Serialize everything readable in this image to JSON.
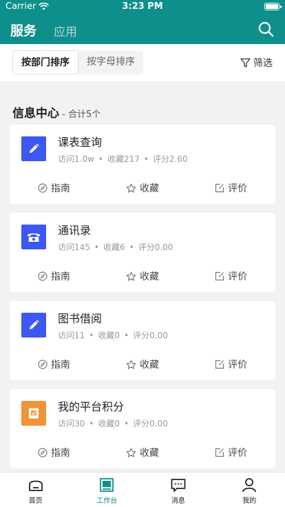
{
  "status": {
    "carrier": "Carrier",
    "time": "3:23 PM"
  },
  "header": {
    "tab_service": "服务",
    "tab_app": "应用"
  },
  "sort": {
    "by_dept": "按部门排序",
    "by_letter": "按字母排序",
    "filter": "筛选"
  },
  "section": {
    "title": "信息中心",
    "total": " - 合计5个"
  },
  "actions": {
    "guide": "指南",
    "favorite": "收藏",
    "review": "评价"
  },
  "colors": {
    "primary": "#0f8f8b",
    "icon_blue": "#3d57f4",
    "icon_orange": "#f09435"
  },
  "cards": [
    {
      "title": "课表查询",
      "visits": "访问1.0w",
      "favorites": "收藏217",
      "rating": "评分2.60",
      "icon": "pencil-icon"
    },
    {
      "title": "通讯录",
      "visits": "访问145",
      "favorites": "收藏6",
      "rating": "评分0.00",
      "icon": "phone-icon"
    },
    {
      "title": "图书借阅",
      "visits": "访问11",
      "favorites": "收藏0",
      "rating": "评分0.00",
      "icon": "pencil-icon"
    },
    {
      "title": "我的平台积分",
      "visits": "访问30",
      "favorites": "收藏0",
      "rating": "评分0.00",
      "icon": "points-icon"
    }
  ],
  "tabbar": {
    "home": "首页",
    "workbench": "工作台",
    "messages": "消息",
    "mine": "我的"
  }
}
